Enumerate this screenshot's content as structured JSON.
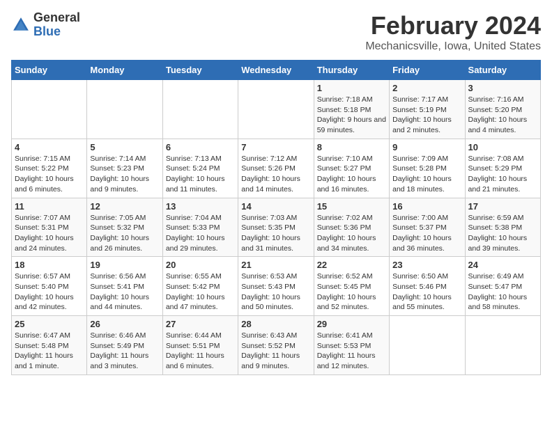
{
  "header": {
    "logo_general": "General",
    "logo_blue": "Blue",
    "month_title": "February 2024",
    "location": "Mechanicsville, Iowa, United States"
  },
  "days_of_week": [
    "Sunday",
    "Monday",
    "Tuesday",
    "Wednesday",
    "Thursday",
    "Friday",
    "Saturday"
  ],
  "weeks": [
    [
      {
        "day": "",
        "sunrise": "",
        "sunset": "",
        "daylight": "",
        "empty": true
      },
      {
        "day": "",
        "sunrise": "",
        "sunset": "",
        "daylight": "",
        "empty": true
      },
      {
        "day": "",
        "sunrise": "",
        "sunset": "",
        "daylight": "",
        "empty": true
      },
      {
        "day": "",
        "sunrise": "",
        "sunset": "",
        "daylight": "",
        "empty": true
      },
      {
        "day": "1",
        "sunrise": "Sunrise: 7:18 AM",
        "sunset": "Sunset: 5:18 PM",
        "daylight": "Daylight: 9 hours and 59 minutes.",
        "empty": false
      },
      {
        "day": "2",
        "sunrise": "Sunrise: 7:17 AM",
        "sunset": "Sunset: 5:19 PM",
        "daylight": "Daylight: 10 hours and 2 minutes.",
        "empty": false
      },
      {
        "day": "3",
        "sunrise": "Sunrise: 7:16 AM",
        "sunset": "Sunset: 5:20 PM",
        "daylight": "Daylight: 10 hours and 4 minutes.",
        "empty": false
      }
    ],
    [
      {
        "day": "4",
        "sunrise": "Sunrise: 7:15 AM",
        "sunset": "Sunset: 5:22 PM",
        "daylight": "Daylight: 10 hours and 6 minutes.",
        "empty": false
      },
      {
        "day": "5",
        "sunrise": "Sunrise: 7:14 AM",
        "sunset": "Sunset: 5:23 PM",
        "daylight": "Daylight: 10 hours and 9 minutes.",
        "empty": false
      },
      {
        "day": "6",
        "sunrise": "Sunrise: 7:13 AM",
        "sunset": "Sunset: 5:24 PM",
        "daylight": "Daylight: 10 hours and 11 minutes.",
        "empty": false
      },
      {
        "day": "7",
        "sunrise": "Sunrise: 7:12 AM",
        "sunset": "Sunset: 5:26 PM",
        "daylight": "Daylight: 10 hours and 14 minutes.",
        "empty": false
      },
      {
        "day": "8",
        "sunrise": "Sunrise: 7:10 AM",
        "sunset": "Sunset: 5:27 PM",
        "daylight": "Daylight: 10 hours and 16 minutes.",
        "empty": false
      },
      {
        "day": "9",
        "sunrise": "Sunrise: 7:09 AM",
        "sunset": "Sunset: 5:28 PM",
        "daylight": "Daylight: 10 hours and 18 minutes.",
        "empty": false
      },
      {
        "day": "10",
        "sunrise": "Sunrise: 7:08 AM",
        "sunset": "Sunset: 5:29 PM",
        "daylight": "Daylight: 10 hours and 21 minutes.",
        "empty": false
      }
    ],
    [
      {
        "day": "11",
        "sunrise": "Sunrise: 7:07 AM",
        "sunset": "Sunset: 5:31 PM",
        "daylight": "Daylight: 10 hours and 24 minutes.",
        "empty": false
      },
      {
        "day": "12",
        "sunrise": "Sunrise: 7:05 AM",
        "sunset": "Sunset: 5:32 PM",
        "daylight": "Daylight: 10 hours and 26 minutes.",
        "empty": false
      },
      {
        "day": "13",
        "sunrise": "Sunrise: 7:04 AM",
        "sunset": "Sunset: 5:33 PM",
        "daylight": "Daylight: 10 hours and 29 minutes.",
        "empty": false
      },
      {
        "day": "14",
        "sunrise": "Sunrise: 7:03 AM",
        "sunset": "Sunset: 5:35 PM",
        "daylight": "Daylight: 10 hours and 31 minutes.",
        "empty": false
      },
      {
        "day": "15",
        "sunrise": "Sunrise: 7:02 AM",
        "sunset": "Sunset: 5:36 PM",
        "daylight": "Daylight: 10 hours and 34 minutes.",
        "empty": false
      },
      {
        "day": "16",
        "sunrise": "Sunrise: 7:00 AM",
        "sunset": "Sunset: 5:37 PM",
        "daylight": "Daylight: 10 hours and 36 minutes.",
        "empty": false
      },
      {
        "day": "17",
        "sunrise": "Sunrise: 6:59 AM",
        "sunset": "Sunset: 5:38 PM",
        "daylight": "Daylight: 10 hours and 39 minutes.",
        "empty": false
      }
    ],
    [
      {
        "day": "18",
        "sunrise": "Sunrise: 6:57 AM",
        "sunset": "Sunset: 5:40 PM",
        "daylight": "Daylight: 10 hours and 42 minutes.",
        "empty": false
      },
      {
        "day": "19",
        "sunrise": "Sunrise: 6:56 AM",
        "sunset": "Sunset: 5:41 PM",
        "daylight": "Daylight: 10 hours and 44 minutes.",
        "empty": false
      },
      {
        "day": "20",
        "sunrise": "Sunrise: 6:55 AM",
        "sunset": "Sunset: 5:42 PM",
        "daylight": "Daylight: 10 hours and 47 minutes.",
        "empty": false
      },
      {
        "day": "21",
        "sunrise": "Sunrise: 6:53 AM",
        "sunset": "Sunset: 5:43 PM",
        "daylight": "Daylight: 10 hours and 50 minutes.",
        "empty": false
      },
      {
        "day": "22",
        "sunrise": "Sunrise: 6:52 AM",
        "sunset": "Sunset: 5:45 PM",
        "daylight": "Daylight: 10 hours and 52 minutes.",
        "empty": false
      },
      {
        "day": "23",
        "sunrise": "Sunrise: 6:50 AM",
        "sunset": "Sunset: 5:46 PM",
        "daylight": "Daylight: 10 hours and 55 minutes.",
        "empty": false
      },
      {
        "day": "24",
        "sunrise": "Sunrise: 6:49 AM",
        "sunset": "Sunset: 5:47 PM",
        "daylight": "Daylight: 10 hours and 58 minutes.",
        "empty": false
      }
    ],
    [
      {
        "day": "25",
        "sunrise": "Sunrise: 6:47 AM",
        "sunset": "Sunset: 5:48 PM",
        "daylight": "Daylight: 11 hours and 1 minute.",
        "empty": false
      },
      {
        "day": "26",
        "sunrise": "Sunrise: 6:46 AM",
        "sunset": "Sunset: 5:49 PM",
        "daylight": "Daylight: 11 hours and 3 minutes.",
        "empty": false
      },
      {
        "day": "27",
        "sunrise": "Sunrise: 6:44 AM",
        "sunset": "Sunset: 5:51 PM",
        "daylight": "Daylight: 11 hours and 6 minutes.",
        "empty": false
      },
      {
        "day": "28",
        "sunrise": "Sunrise: 6:43 AM",
        "sunset": "Sunset: 5:52 PM",
        "daylight": "Daylight: 11 hours and 9 minutes.",
        "empty": false
      },
      {
        "day": "29",
        "sunrise": "Sunrise: 6:41 AM",
        "sunset": "Sunset: 5:53 PM",
        "daylight": "Daylight: 11 hours and 12 minutes.",
        "empty": false
      },
      {
        "day": "",
        "sunrise": "",
        "sunset": "",
        "daylight": "",
        "empty": true
      },
      {
        "day": "",
        "sunrise": "",
        "sunset": "",
        "daylight": "",
        "empty": true
      }
    ]
  ]
}
